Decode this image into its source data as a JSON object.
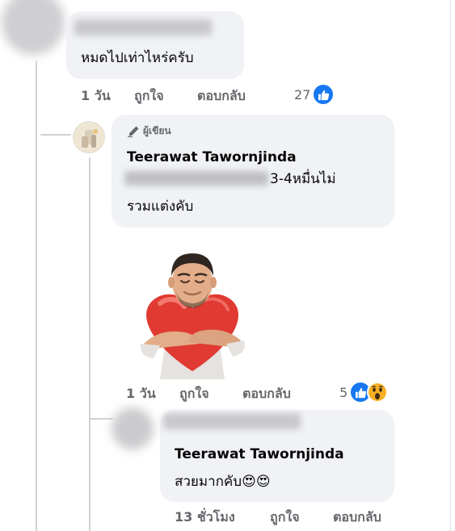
{
  "comment1": {
    "text": "หมดไปเท่าไหร่ครับ",
    "time": "1 วัน",
    "like_label": "ถูกใจ",
    "reply_label": "ตอบกลับ",
    "reaction_count": "27",
    "reaction_icons": [
      "like-icon"
    ]
  },
  "reply1": {
    "badge": "ผู้เขียน",
    "name": "Teerawat Tawornjinda",
    "text_line1_tail": "3-4หมื่นไม่",
    "text_line2": "รวมแต่งคับ"
  },
  "reply2": {
    "sticker": "man-hugging-heart-sticker",
    "time": "1 วัน",
    "like_label": "ถูกใจ",
    "reply_label": "ตอบกลับ",
    "reaction_count": "5",
    "reaction_icons": [
      "like-icon",
      "wow-icon"
    ]
  },
  "reply3": {
    "name": "Teerawat Tawornjinda",
    "text": "สวยมากคับ",
    "emojis": "😍😍",
    "time": "13 ชั่วโมง",
    "like_label": "ถูกใจ",
    "reply_label": "ตอบกลับ"
  },
  "colors": {
    "bubble": "#f0f2f5",
    "accent": "#1877f2",
    "thread": "#ced0d4",
    "meta": "#65676b"
  }
}
